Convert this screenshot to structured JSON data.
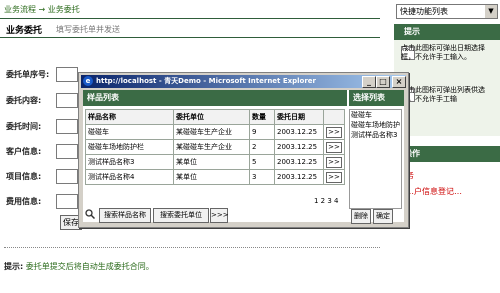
{
  "breadcrumb": {
    "item1": "业务流程",
    "sep": "→",
    "item2": "业务委托"
  },
  "quick_select": "快捷功能列表",
  "page": {
    "title": "业务委托",
    "hint": "填写委托单并发送"
  },
  "form": {
    "labels": [
      "委托单序号:",
      "委托内容:",
      "委托时间:",
      "客户信息:",
      "项目信息:",
      "费用信息:"
    ],
    "save_button": "保存"
  },
  "footer": {
    "prefix": "提示:",
    "text": "委托单提交后将自动生成委托合同。"
  },
  "right_panel": {
    "tips_title": "提示",
    "tip1": "点击此图标可弹出日期选择框，不允许手工输入。",
    "tip2": "点击此图标可弹出列表供选择，不允许手工输",
    "ops_title": "操作",
    "op1": "…户信息登记…",
    "op_partial": "务"
  },
  "popup": {
    "title": "http://localhost - 青天Demo - Microsoft Internet Explorer",
    "sample_list_title": "样品列表",
    "selected_list_title": "选择列表",
    "columns": [
      "样品名称",
      "委托单位",
      "数量",
      "委托日期"
    ],
    "rows": [
      {
        "name": "碰碰车",
        "unit": "某碰碰车生产企业",
        "qty": "9",
        "date": "2003.12.25"
      },
      {
        "name": "碰碰车场地防护栏",
        "unit": "某碰碰车生产企业",
        "qty": "2",
        "date": "2003.12.25"
      },
      {
        "name": "测试样品名称3",
        "unit": "某单位",
        "qty": "5",
        "date": "2003.12.25"
      },
      {
        "name": "测试样品名称4",
        "unit": "某单位",
        "qty": "3",
        "date": "2003.12.25"
      }
    ],
    "add_symbol": ">>",
    "pagination": "1 2 3 4",
    "search_name_label": "搜索样品名称",
    "search_unit_label": "搜索委托单位",
    "search_go": ">>>",
    "selected_items": [
      "碰碰车",
      "碰碰车场地防护",
      "测试样品名称3"
    ],
    "delete_button": "删除",
    "confirm_button": "确定"
  }
}
